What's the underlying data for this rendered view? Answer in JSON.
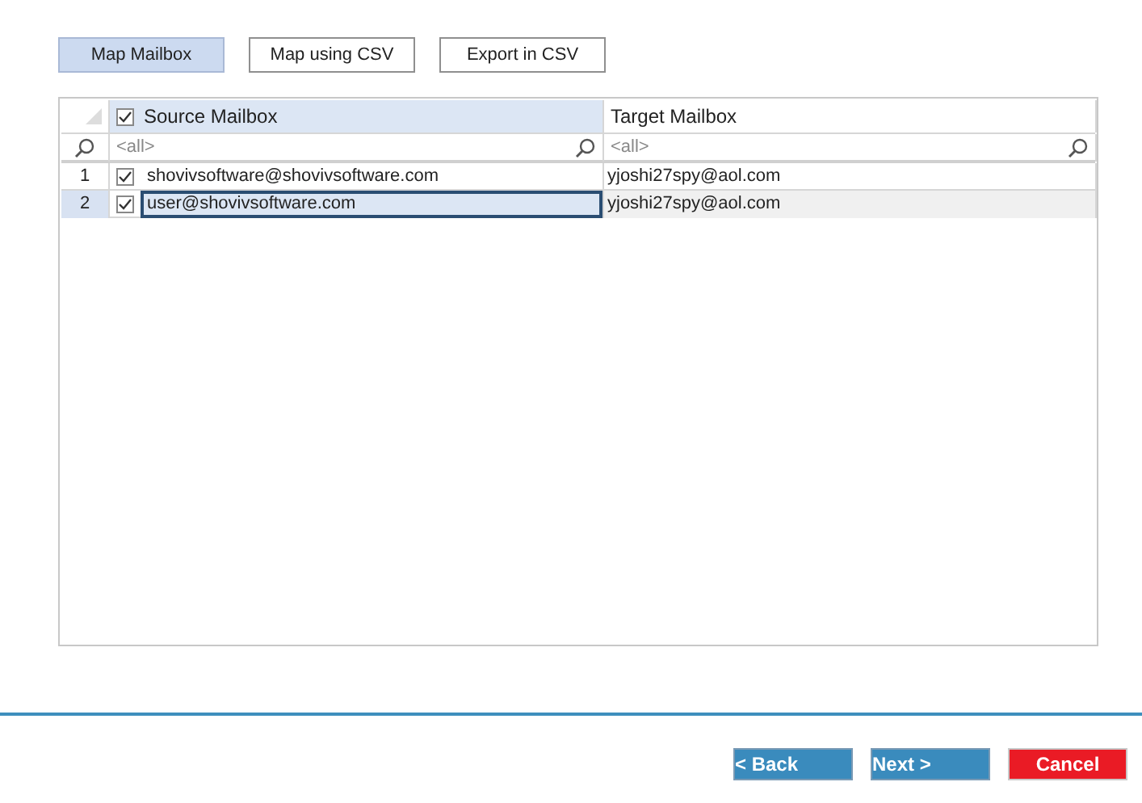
{
  "toolbar": [
    {
      "label": "Map Mailbox",
      "selected": true
    },
    {
      "label": "Map using CSV",
      "selected": false
    },
    {
      "label": "Export in CSV",
      "selected": false
    }
  ],
  "grid": {
    "columns": [
      {
        "label": "Source Mailbox",
        "kind": "checkbox",
        "checked": true,
        "selected": true
      },
      {
        "label": "Target Mailbox",
        "kind": "plain",
        "selected": false
      }
    ],
    "filters": [
      {
        "placeholder": "<all>"
      },
      {
        "placeholder": "<all>"
      }
    ],
    "rows": [
      {
        "number": "1",
        "checked": true,
        "selected": false,
        "source": "shovivsoftware@shovivsoftware.com",
        "target": "yjoshi27spy@aol.com"
      },
      {
        "number": "2",
        "checked": true,
        "selected": true,
        "source": "user@shovivsoftware.com",
        "target": "yjoshi27spy@aol.com"
      }
    ]
  },
  "footer": [
    {
      "label": "< Back",
      "kind": "nav"
    },
    {
      "label": "Next >",
      "kind": "nav"
    },
    {
      "label": "Cancel",
      "kind": "cancel"
    }
  ]
}
